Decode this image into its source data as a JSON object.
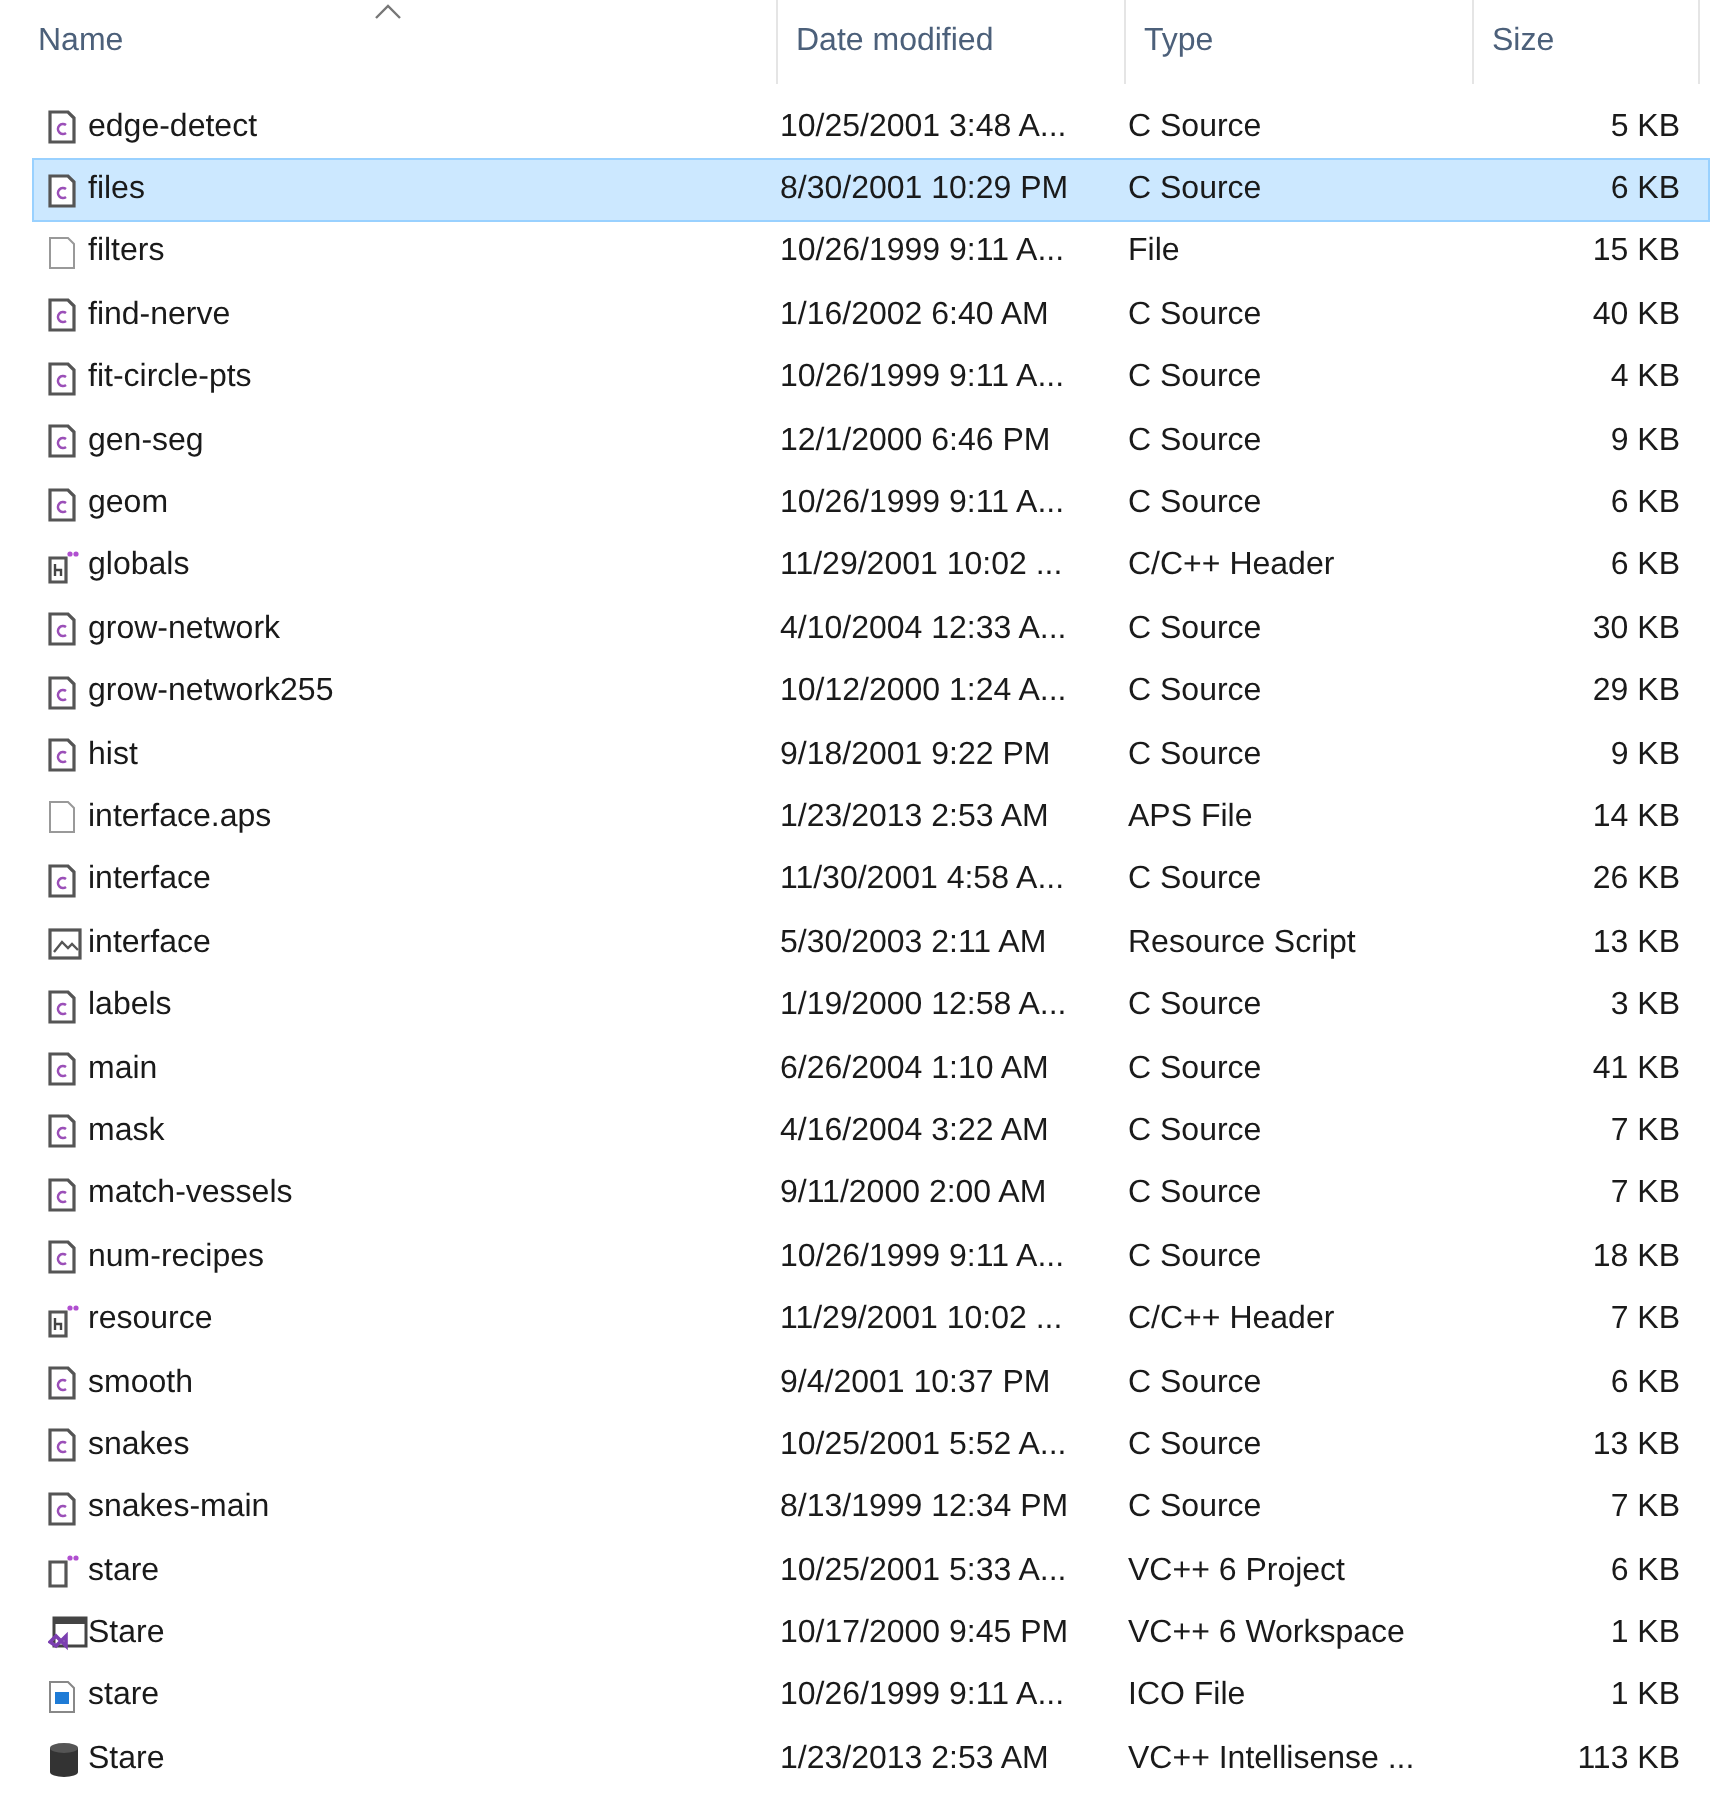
{
  "columns": [
    {
      "label": "Name",
      "sorted": true
    },
    {
      "label": "Date modified",
      "sorted": false
    },
    {
      "label": "Type",
      "sorted": false
    },
    {
      "label": "Size",
      "sorted": false
    }
  ],
  "files": [
    {
      "kind": "c",
      "name": "edge-detect",
      "date": "10/25/2001 3:48 A...",
      "type": "C Source",
      "size": "5 KB",
      "selected": false
    },
    {
      "kind": "c",
      "name": "files",
      "date": "8/30/2001 10:29 PM",
      "type": "C Source",
      "size": "6 KB",
      "selected": true
    },
    {
      "kind": "file",
      "name": "filters",
      "date": "10/26/1999 9:11 A...",
      "type": "File",
      "size": "15 KB",
      "selected": false
    },
    {
      "kind": "c",
      "name": "find-nerve",
      "date": "1/16/2002 6:40 AM",
      "type": "C Source",
      "size": "40 KB",
      "selected": false
    },
    {
      "kind": "c",
      "name": "fit-circle-pts",
      "date": "10/26/1999 9:11 A...",
      "type": "C Source",
      "size": "4 KB",
      "selected": false
    },
    {
      "kind": "c",
      "name": "gen-seg",
      "date": "12/1/2000 6:46 PM",
      "type": "C Source",
      "size": "9 KB",
      "selected": false
    },
    {
      "kind": "c",
      "name": "geom",
      "date": "10/26/1999 9:11 A...",
      "type": "C Source",
      "size": "6 KB",
      "selected": false
    },
    {
      "kind": "h",
      "name": "globals",
      "date": "11/29/2001 10:02 ...",
      "type": "C/C++ Header",
      "size": "6 KB",
      "selected": false
    },
    {
      "kind": "c",
      "name": "grow-network",
      "date": "4/10/2004 12:33 A...",
      "type": "C Source",
      "size": "30 KB",
      "selected": false
    },
    {
      "kind": "c",
      "name": "grow-network255",
      "date": "10/12/2000 1:24 A...",
      "type": "C Source",
      "size": "29 KB",
      "selected": false
    },
    {
      "kind": "c",
      "name": "hist",
      "date": "9/18/2001 9:22 PM",
      "type": "C Source",
      "size": "9 KB",
      "selected": false
    },
    {
      "kind": "file",
      "name": "interface.aps",
      "date": "1/23/2013 2:53 AM",
      "type": "APS File",
      "size": "14 KB",
      "selected": false
    },
    {
      "kind": "c",
      "name": "interface",
      "date": "11/30/2001 4:58 A...",
      "type": "C Source",
      "size": "26 KB",
      "selected": false
    },
    {
      "kind": "rc",
      "name": "interface",
      "date": "5/30/2003 2:11 AM",
      "type": "Resource Script",
      "size": "13 KB",
      "selected": false
    },
    {
      "kind": "c",
      "name": "labels",
      "date": "1/19/2000 12:58 A...",
      "type": "C Source",
      "size": "3 KB",
      "selected": false
    },
    {
      "kind": "c",
      "name": "main",
      "date": "6/26/2004 1:10 AM",
      "type": "C Source",
      "size": "41 KB",
      "selected": false
    },
    {
      "kind": "c",
      "name": "mask",
      "date": "4/16/2004 3:22 AM",
      "type": "C Source",
      "size": "7 KB",
      "selected": false
    },
    {
      "kind": "c",
      "name": "match-vessels",
      "date": "9/11/2000 2:00 AM",
      "type": "C Source",
      "size": "7 KB",
      "selected": false
    },
    {
      "kind": "c",
      "name": "num-recipes",
      "date": "10/26/1999 9:11 A...",
      "type": "C Source",
      "size": "18 KB",
      "selected": false
    },
    {
      "kind": "h",
      "name": "resource",
      "date": "11/29/2001 10:02 ...",
      "type": "C/C++ Header",
      "size": "7 KB",
      "selected": false
    },
    {
      "kind": "c",
      "name": "smooth",
      "date": "9/4/2001 10:37 PM",
      "type": "C Source",
      "size": "6 KB",
      "selected": false
    },
    {
      "kind": "c",
      "name": "snakes",
      "date": "10/25/2001 5:52 A...",
      "type": "C Source",
      "size": "13 KB",
      "selected": false
    },
    {
      "kind": "c",
      "name": "snakes-main",
      "date": "8/13/1999 12:34 PM",
      "type": "C Source",
      "size": "7 KB",
      "selected": false
    },
    {
      "kind": "proj",
      "name": "stare",
      "date": "10/25/2001 5:33 A...",
      "type": "VC++ 6 Project",
      "size": "6 KB",
      "selected": false
    },
    {
      "kind": "sln",
      "name": "Stare",
      "date": "10/17/2000 9:45 PM",
      "type": "VC++ 6 Workspace",
      "size": "1 KB",
      "selected": false
    },
    {
      "kind": "ico",
      "name": "stare",
      "date": "10/26/1999 9:11 A...",
      "type": "ICO File",
      "size": "1 KB",
      "selected": false
    },
    {
      "kind": "db",
      "name": "Stare",
      "date": "1/23/2013 2:53 AM",
      "type": "VC++ Intellisense ...",
      "size": "113 KB",
      "selected": false
    }
  ]
}
